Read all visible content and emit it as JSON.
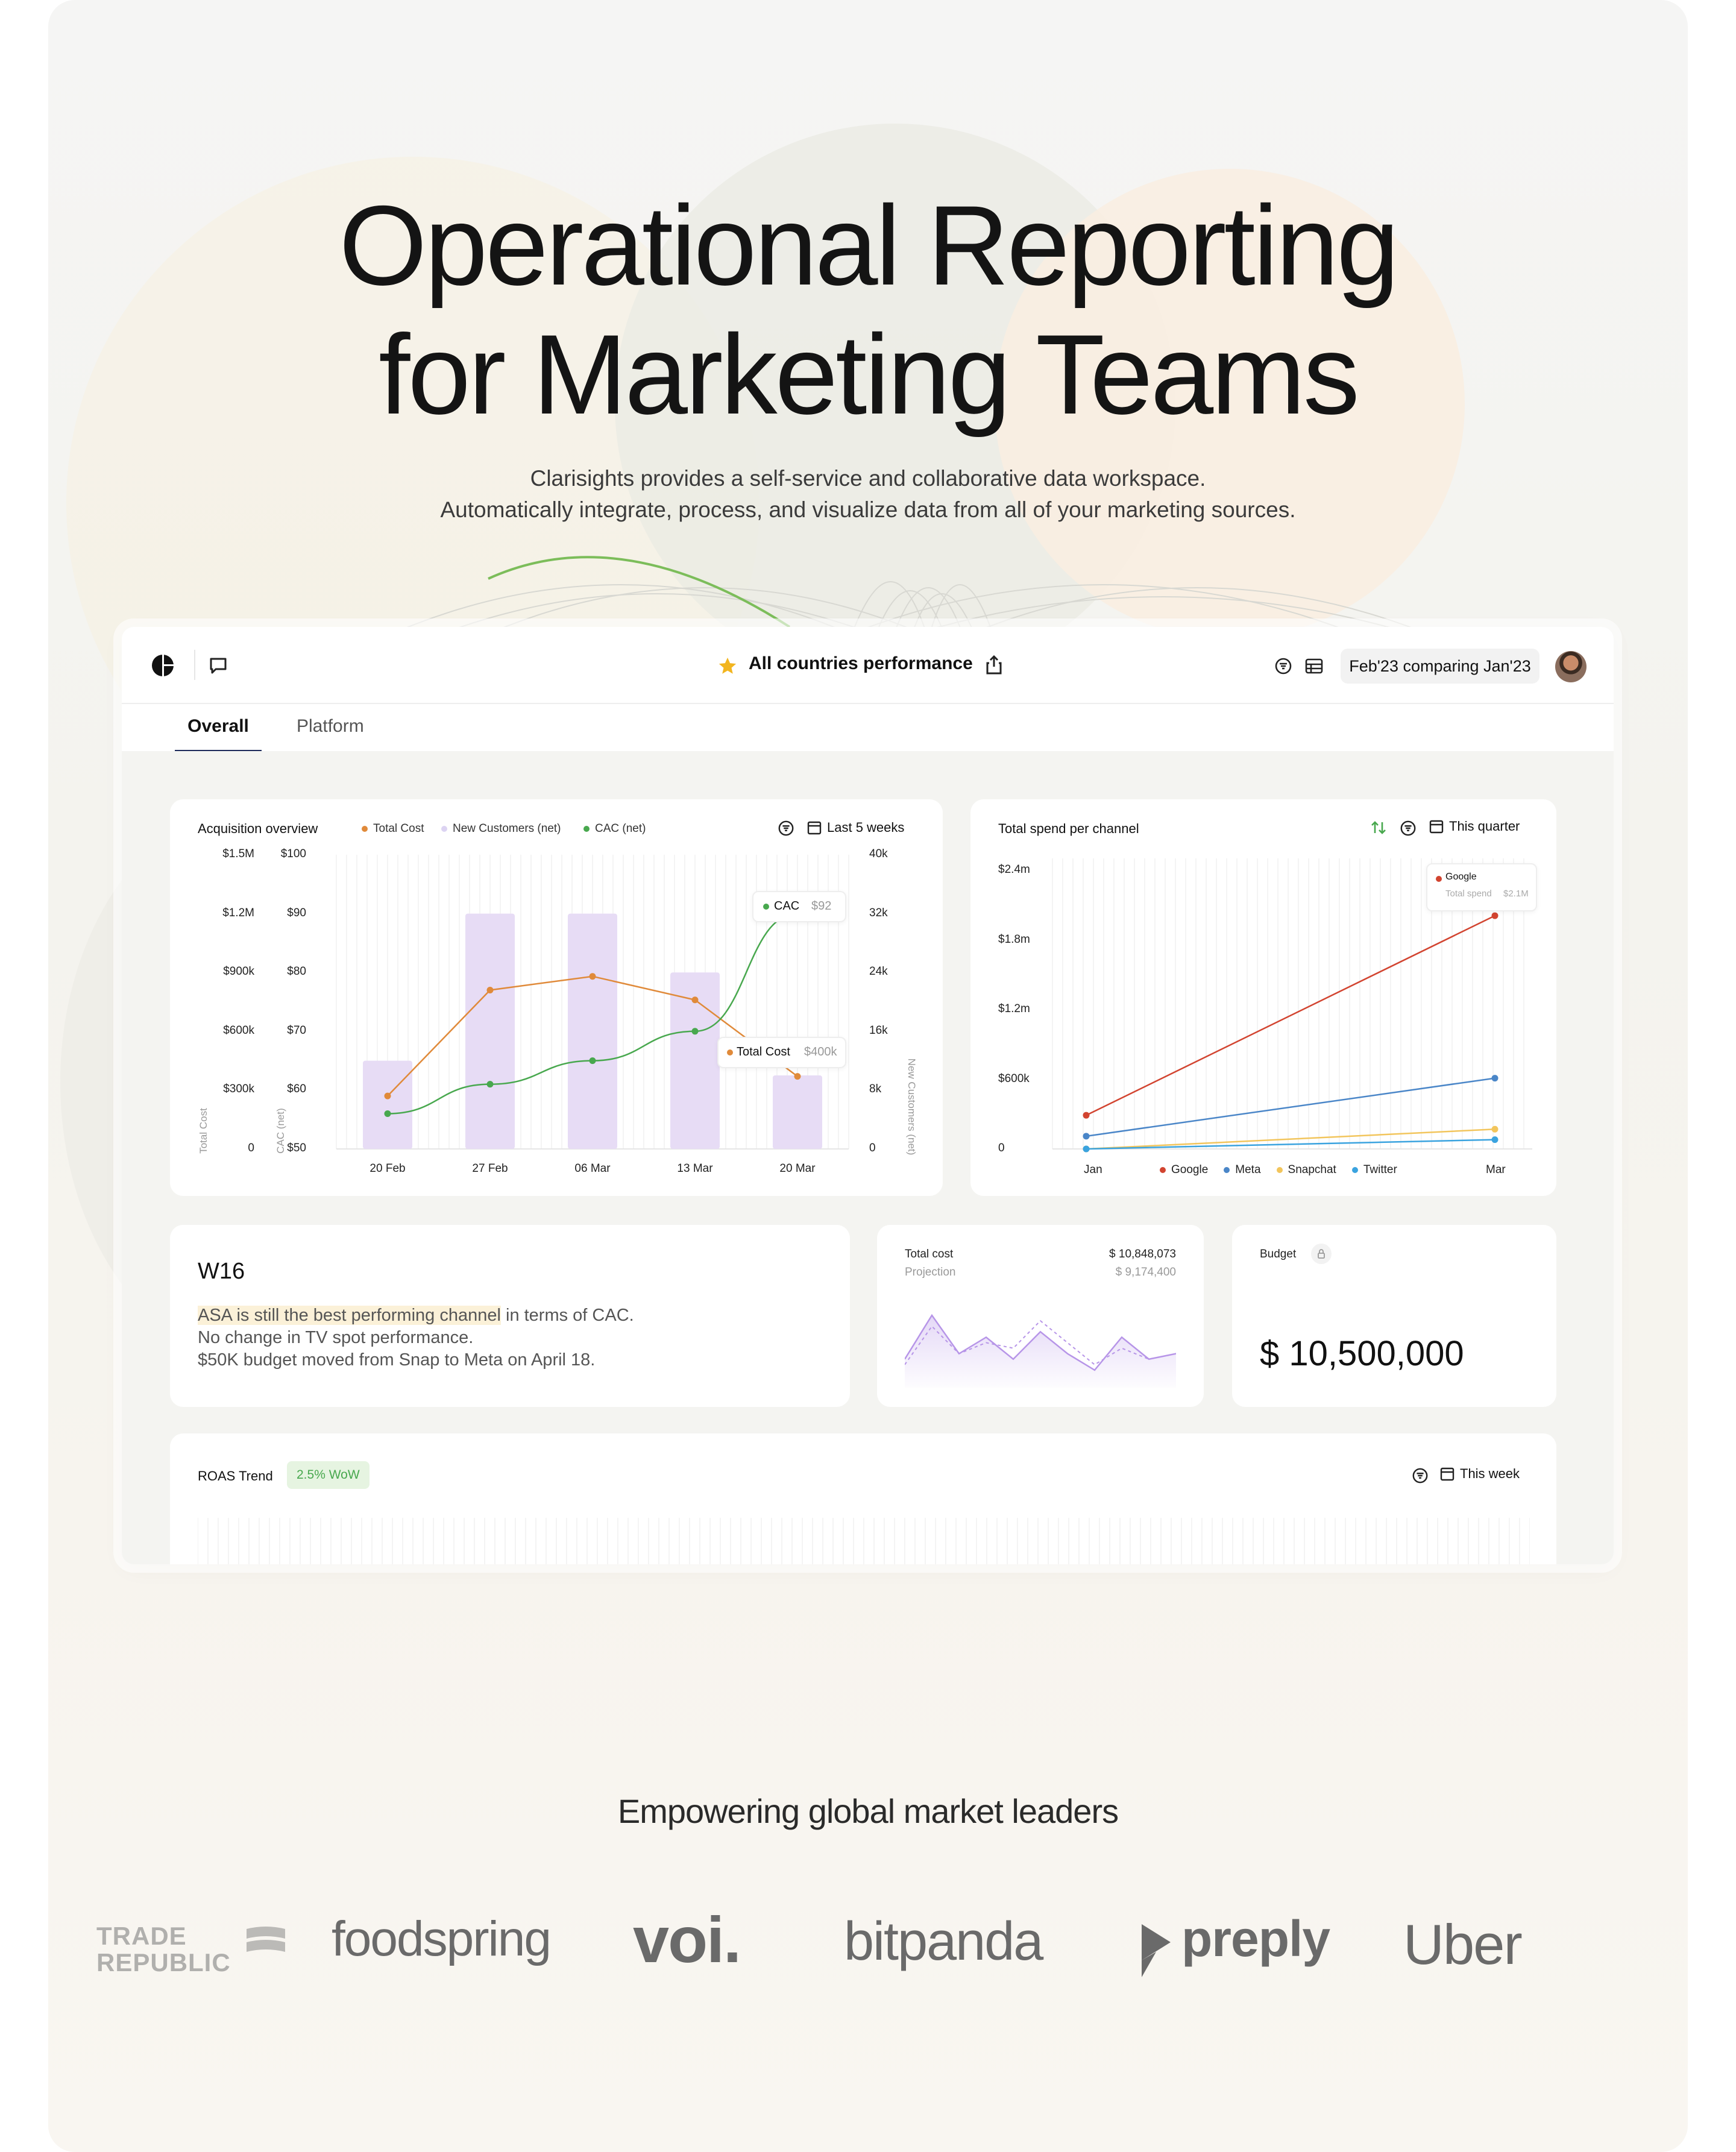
{
  "hero": {
    "title_line1": "Operational Reporting",
    "title_line2": "for Marketing Teams",
    "subtitle_line1": "Clarisights provides a self-service and collaborative data workspace.",
    "subtitle_line2": "Automatically integrate, process, and visualize data from all of your marketing sources."
  },
  "app": {
    "report_title": "All countries performance",
    "date_comparison": "Feb'23 comparing Jan'23",
    "icons": [
      "clarisights-logo-icon",
      "comment-icon",
      "star-icon",
      "share-icon",
      "filter-icon",
      "table-icon"
    ],
    "tabs": [
      {
        "label": "Overall",
        "active": true
      },
      {
        "label": "Platform",
        "active": false
      }
    ]
  },
  "acquisition": {
    "title": "Acquisition overview",
    "legend": [
      {
        "label": "Total Cost",
        "color": "#e08a3a"
      },
      {
        "label": "New Customers (net)",
        "color": "#dcd3f2"
      },
      {
        "label": "CAC (net)",
        "color": "#48a84e"
      }
    ],
    "range_label": "Last 5 weeks",
    "y_cost_ticks": [
      "$1.5M",
      "$1.2M",
      "$900k",
      "$600k",
      "$300k",
      "0"
    ],
    "y_cac_ticks": [
      "$100",
      "$90",
      "$80",
      "$70",
      "$60",
      "$50"
    ],
    "y_cust_ticks": [
      "40k",
      "32k",
      "24k",
      "16k",
      "8k",
      "0"
    ],
    "y_cost_label": "Total Cost",
    "y_cac_label": "CAC (net)",
    "y_cust_label": "New Customers (net)",
    "tooltip_cac_label": "CAC",
    "tooltip_cac_value": "$92",
    "tooltip_cost_label": "Total Cost",
    "tooltip_cost_value": "$400k"
  },
  "spend": {
    "title": "Total spend per channel",
    "range_label": "This quarter",
    "y_ticks": [
      "$2.4m",
      "$1.8m",
      "$1.2m",
      "$600k",
      "0"
    ],
    "x_start": "Jan",
    "x_end": "Mar",
    "legend": [
      {
        "label": "Google",
        "color": "#d24430"
      },
      {
        "label": "Meta",
        "color": "#4a86c8"
      },
      {
        "label": "Snapchat",
        "color": "#f2c55c"
      },
      {
        "label": "Twitter",
        "color": "#3aa3df"
      }
    ],
    "tooltip_title": "Google",
    "tooltip_label": "Total spend",
    "tooltip_value": "$2.1M"
  },
  "chart_data": [
    {
      "type": "bar",
      "title": "Acquisition overview",
      "categories": [
        "20 Feb",
        "27 Feb",
        "06 Mar",
        "13 Mar",
        "20 Mar"
      ],
      "series": [
        {
          "name": "New Customers (net)",
          "axis": "right",
          "values": [
            12000,
            32000,
            32000,
            24000,
            10000
          ]
        },
        {
          "name": "Total Cost",
          "type": "line",
          "axis": "left",
          "values": [
            270000,
            810000,
            880000,
            760000,
            370000
          ]
        },
        {
          "name": "CAC (net)",
          "type": "line",
          "axis": "left2",
          "values": [
            56,
            61,
            65,
            70,
            90
          ]
        }
      ],
      "ylim_cost": [
        0,
        1500000
      ],
      "ylim_cac": [
        50,
        100
      ],
      "ylim_customers": [
        0,
        40000
      ]
    },
    {
      "type": "line",
      "title": "Total spend per channel",
      "x": [
        "Jan",
        "Mar"
      ],
      "series": [
        {
          "name": "Google",
          "values": [
            290000,
            2010000
          ]
        },
        {
          "name": "Meta",
          "values": [
            110000,
            610000
          ]
        },
        {
          "name": "Snapchat",
          "values": [
            0,
            170000
          ]
        },
        {
          "name": "Twitter",
          "values": [
            0,
            80000
          ]
        }
      ],
      "ylim": [
        0,
        2400000
      ]
    },
    {
      "type": "area",
      "title": "Total cost",
      "series": [
        {
          "name": "Total cost",
          "values": [
            3,
            11,
            4,
            7,
            3,
            8,
            4,
            1,
            7,
            3,
            4
          ]
        },
        {
          "name": "Projection",
          "values": [
            2,
            9,
            4,
            6,
            5,
            10,
            6,
            2,
            5,
            3,
            4
          ]
        }
      ]
    }
  ],
  "insight": {
    "week": "W16",
    "line1_highlight": "ASA is still the best performing channel",
    "line1_rest": " in terms of CAC.",
    "line2": "No change in TV spot performance.",
    "line3": "$50K budget moved from Snap to Meta on April 18."
  },
  "totalcost": {
    "label": "Total cost",
    "value": "$ 10,848,073",
    "projection_label": "Projection",
    "projection_value": "$ 9,174,400"
  },
  "budget": {
    "label": "Budget",
    "value": "$ 10,500,000"
  },
  "roas": {
    "title": "ROAS Trend",
    "badge": "2.5% WoW",
    "range_label": "This week"
  },
  "logos": {
    "heading": "Empowering global market leaders",
    "items": [
      "TRADE REPUBLIC",
      "foodspring",
      "voi.",
      "bitpanda",
      "preply",
      "Uber"
    ]
  }
}
